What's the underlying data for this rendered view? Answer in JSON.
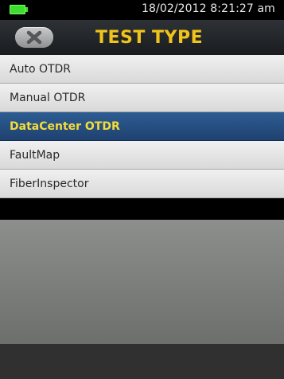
{
  "status_bar": {
    "datetime": "18/02/2012 8:21:27 am",
    "battery_color": "#3ddc2e"
  },
  "header": {
    "title": "TEST TYPE",
    "back_icon": "close-x-icon"
  },
  "test_types": [
    {
      "label": "Auto OTDR",
      "selected": false
    },
    {
      "label": "Manual OTDR",
      "selected": false
    },
    {
      "label": "DataCenter OTDR",
      "selected": true
    },
    {
      "label": "FaultMap",
      "selected": false
    },
    {
      "label": "FiberInspector",
      "selected": false
    }
  ],
  "colors": {
    "title": "#f0c419",
    "selected_background": "#2a5388",
    "selected_text": "#f4dc3a"
  }
}
